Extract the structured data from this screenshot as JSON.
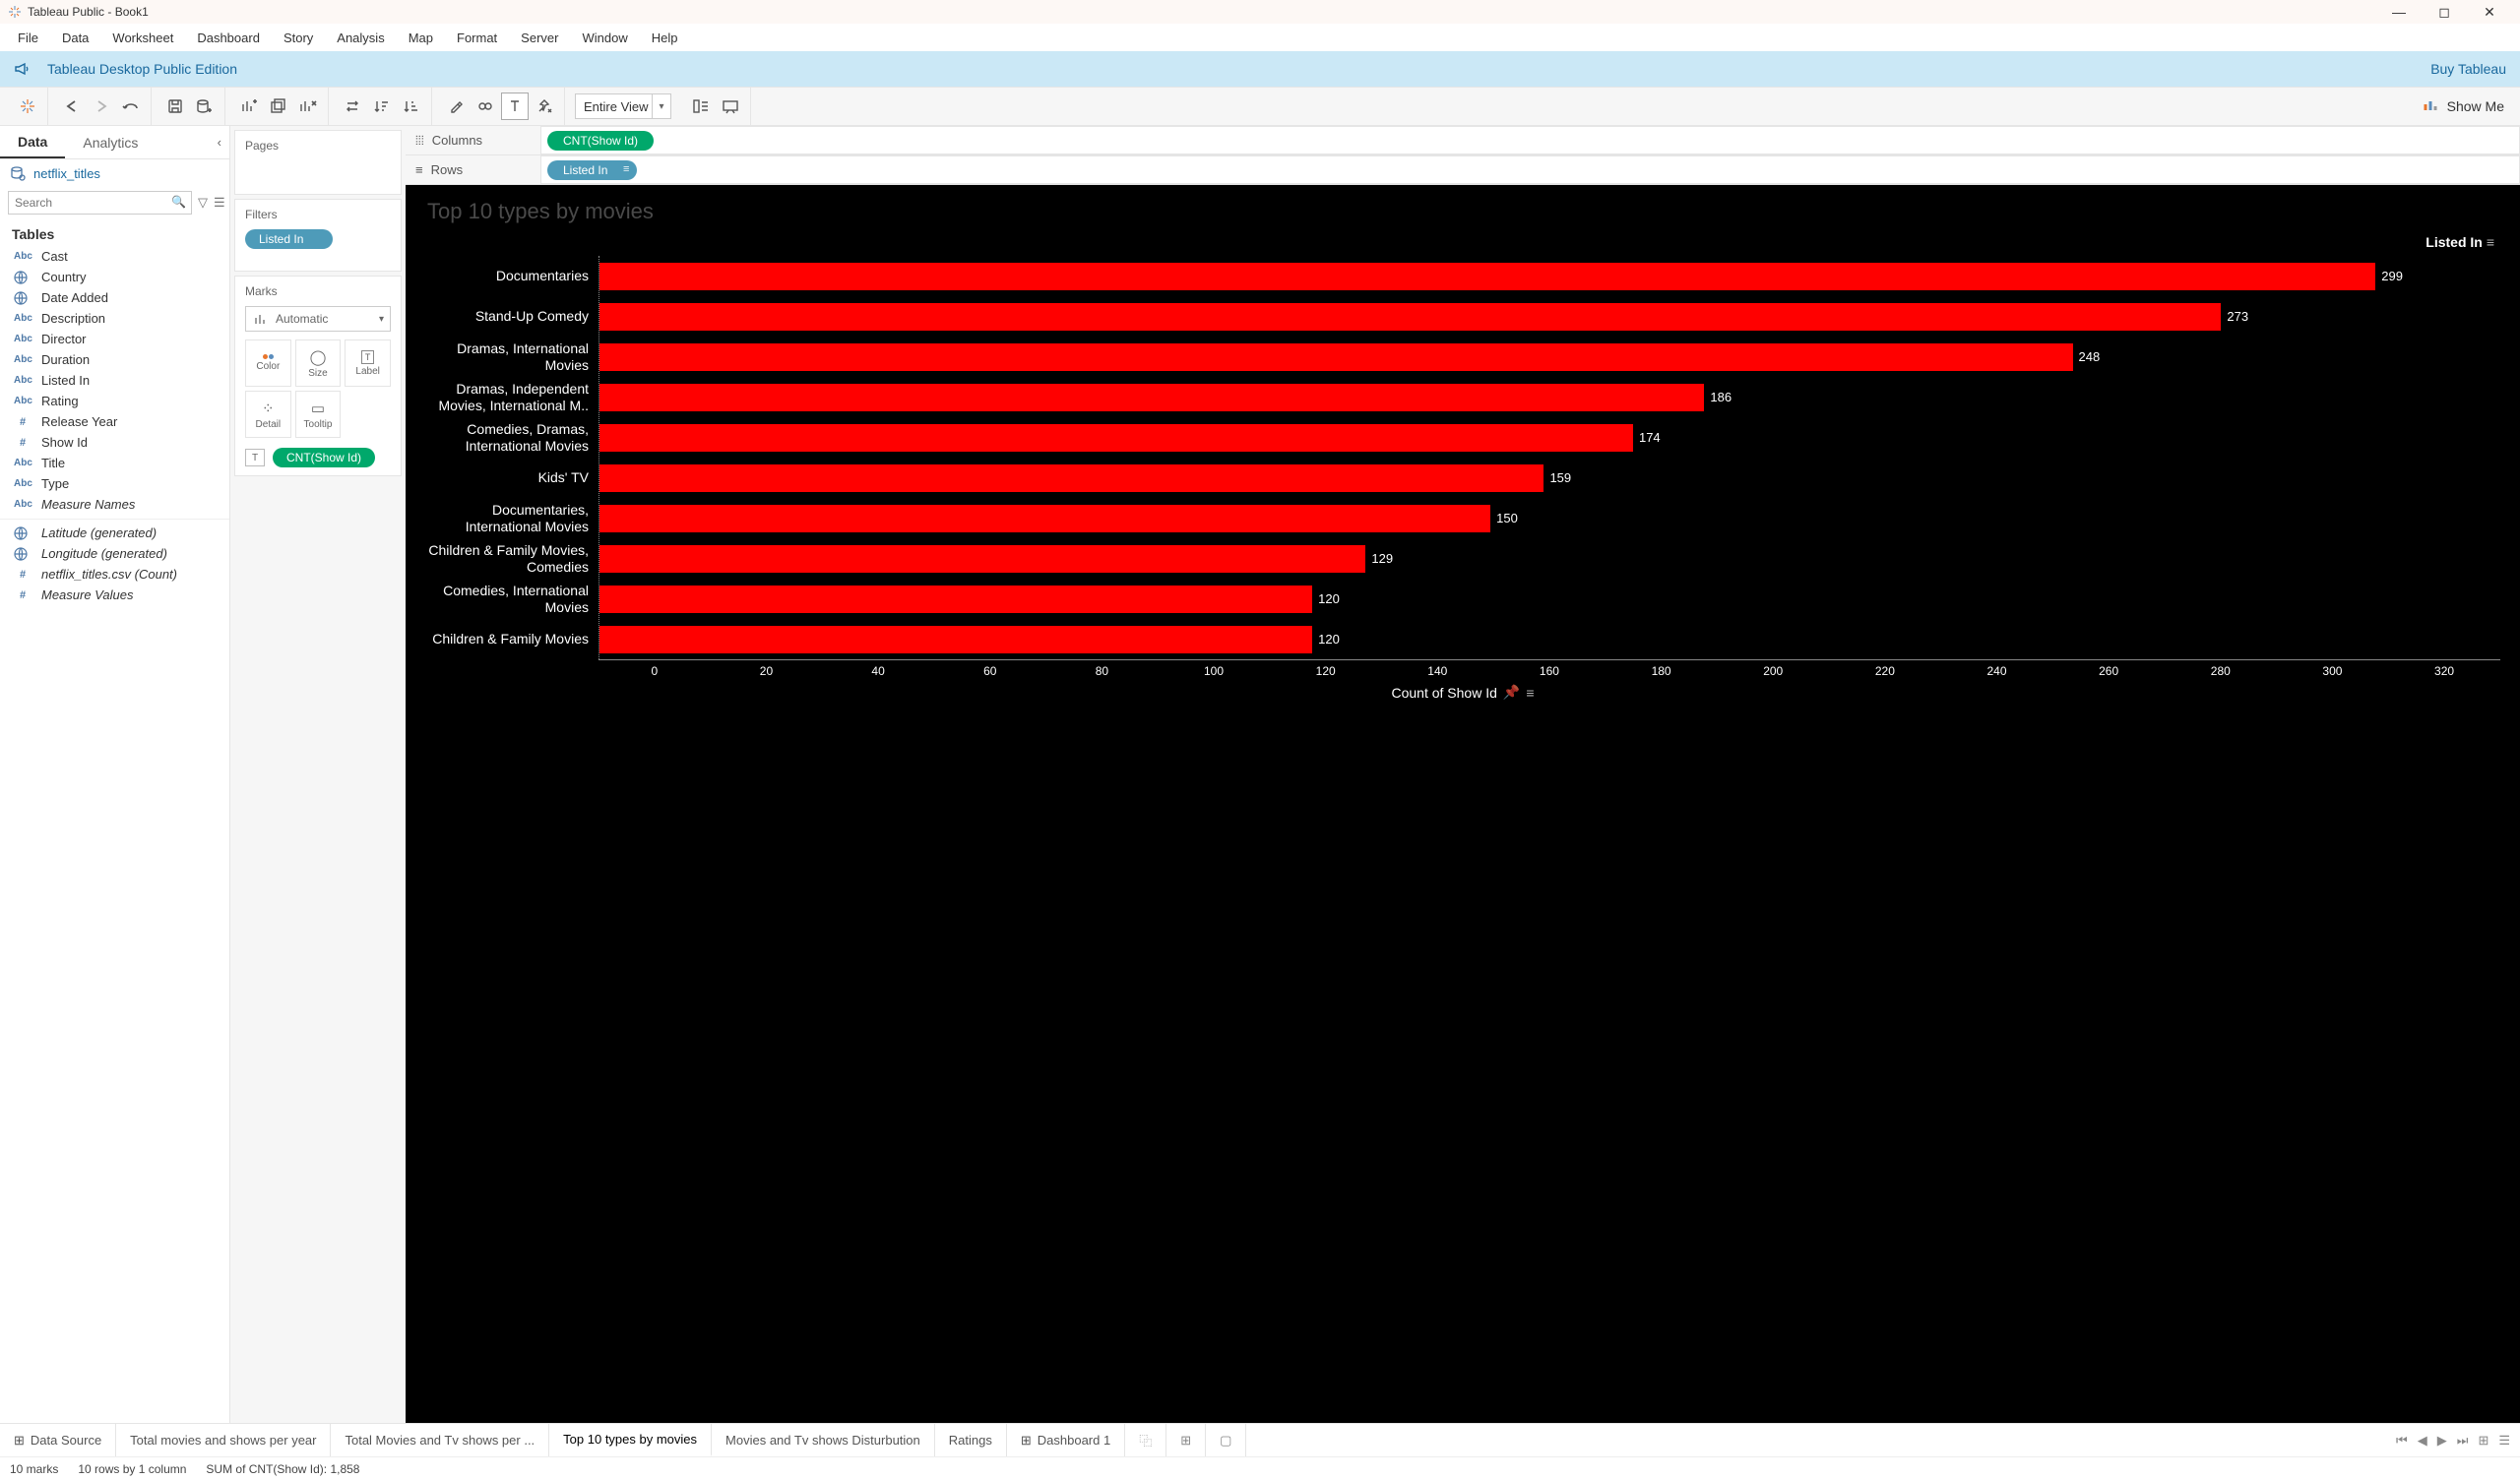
{
  "window": {
    "title": "Tableau Public - Book1"
  },
  "menu": [
    "File",
    "Data",
    "Worksheet",
    "Dashboard",
    "Story",
    "Analysis",
    "Map",
    "Format",
    "Server",
    "Window",
    "Help"
  ],
  "banner": {
    "left": "Tableau Desktop Public Edition",
    "right": "Buy Tableau"
  },
  "toolbar": {
    "fit": "Entire View",
    "showme": "Show Me"
  },
  "leftpanel": {
    "tabs": [
      "Data",
      "Analytics"
    ],
    "datasource": "netflix_titles",
    "search_placeholder": "Search",
    "tables_header": "Tables",
    "fields": [
      {
        "icon": "abc",
        "label": "Cast"
      },
      {
        "icon": "globe",
        "label": "Country"
      },
      {
        "icon": "cal",
        "label": "Date Added"
      },
      {
        "icon": "abc",
        "label": "Description"
      },
      {
        "icon": "abc",
        "label": "Director"
      },
      {
        "icon": "abc",
        "label": "Duration"
      },
      {
        "icon": "abc",
        "label": "Listed In"
      },
      {
        "icon": "abc",
        "label": "Rating"
      },
      {
        "icon": "num",
        "label": "Release Year"
      },
      {
        "icon": "num",
        "label": "Show Id"
      },
      {
        "icon": "abc",
        "label": "Title"
      },
      {
        "icon": "abc",
        "label": "Type"
      },
      {
        "icon": "abc",
        "label": "Measure Names",
        "italic": true
      },
      {
        "icon": "globe",
        "label": "Latitude (generated)",
        "italic": true,
        "sep": true
      },
      {
        "icon": "globe",
        "label": "Longitude (generated)",
        "italic": true
      },
      {
        "icon": "num",
        "label": "netflix_titles.csv (Count)",
        "italic": true
      },
      {
        "icon": "num",
        "label": "Measure Values",
        "italic": true
      }
    ]
  },
  "shelves": {
    "pages": "Pages",
    "filters": "Filters",
    "filters_pill": "Listed In",
    "marks": "Marks",
    "mark_type": "Automatic",
    "mark_cells": [
      "Color",
      "Size",
      "Label",
      "Detail",
      "Tooltip"
    ],
    "mark_pill": "CNT(Show Id)",
    "columns_label": "Columns",
    "columns_pill": "CNT(Show Id)",
    "rows_label": "Rows",
    "rows_pill": "Listed In"
  },
  "viz": {
    "title": "Top 10 types by movies",
    "y_header": "Listed In",
    "x_label": "Count of Show Id"
  },
  "chart_data": {
    "type": "bar",
    "categories": [
      "Documentaries",
      "Stand-Up Comedy",
      "Dramas, International Movies",
      "Dramas, Independent Movies, International M..",
      "Comedies, Dramas, International Movies",
      "Kids' TV",
      "Documentaries, International Movies",
      "Children & Family Movies, Comedies",
      "Comedies, International Movies",
      "Children & Family Movies"
    ],
    "values": [
      299,
      273,
      248,
      186,
      174,
      159,
      150,
      129,
      120,
      120
    ],
    "xticks": [
      0,
      20,
      40,
      60,
      80,
      100,
      120,
      140,
      160,
      180,
      200,
      220,
      240,
      260,
      280,
      300,
      320
    ],
    "xlabel": "Count of Show Id",
    "ylabel": "Listed In",
    "xlim": [
      0,
      320
    ]
  },
  "sheet_tabs": [
    {
      "icon": "ds",
      "label": "Data Source"
    },
    {
      "label": "Total movies and shows per year"
    },
    {
      "label": "Total Movies and Tv shows per ..."
    },
    {
      "label": "Top 10 types by movies",
      "active": true
    },
    {
      "label": "Movies and Tv shows Disturbution"
    },
    {
      "label": "Ratings"
    },
    {
      "icon": "dash",
      "label": "Dashboard 1"
    }
  ],
  "status": {
    "marks": "10 marks",
    "dims": "10 rows by 1 column",
    "sum": "SUM of CNT(Show Id): 1,858"
  }
}
